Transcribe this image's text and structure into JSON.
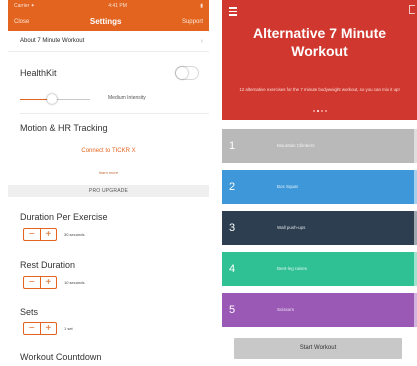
{
  "settings_screen": {
    "status_bar": {
      "carrier": "Carrier ✦",
      "time": "4:41 PM",
      "battery": "▮"
    },
    "nav": {
      "left": "Close",
      "title": "Settings",
      "right": "Support"
    },
    "about_row": {
      "label": "About 7 Minute Workout",
      "chevron": "›"
    },
    "healthkit": {
      "label": "HealthKit",
      "enabled": false
    },
    "intensity": {
      "label": "Medium Intensity",
      "level": 0.45
    },
    "motion": {
      "label": "Motion & HR Tracking",
      "connect_label": "Connect to TICKR X",
      "learn_more": "learn more"
    },
    "pro_upgrade_header": "PRO UPGRADE",
    "pro_settings": [
      {
        "label": "Duration Per Exercise",
        "value": "30 seconds",
        "minus": "−",
        "plus": "+"
      },
      {
        "label": "Rest Duration",
        "value": "10 seconds",
        "minus": "−",
        "plus": "+"
      },
      {
        "label": "Sets",
        "value": "1 set",
        "minus": "−",
        "plus": "+"
      }
    ],
    "workout_countdown": {
      "label": "Workout Countdown"
    },
    "colors": {
      "accent": "#e2641f"
    }
  },
  "workout_screen": {
    "title_line1": "Alternative 7 Minute",
    "title_line2": "Workout",
    "description": "12 alternative exercises for the 7 minute bodyweight workout, so you can mix it up!",
    "page_dots": 4,
    "active_dot": 1,
    "workouts": [
      {
        "number": "1",
        "name": "Mountain Climbers",
        "color": "#b9b9b9"
      },
      {
        "number": "2",
        "name": "Box Squat",
        "color": "#3d97d8"
      },
      {
        "number": "3",
        "name": "Wall push-ups",
        "color": "#2c3e50"
      },
      {
        "number": "4",
        "name": "Bent-leg raises",
        "color": "#2fc193"
      },
      {
        "number": "5",
        "name": "Scissors",
        "color": "#9b59b6"
      }
    ],
    "start_button": "Start Workout",
    "colors": {
      "header": "#d0372e"
    }
  }
}
